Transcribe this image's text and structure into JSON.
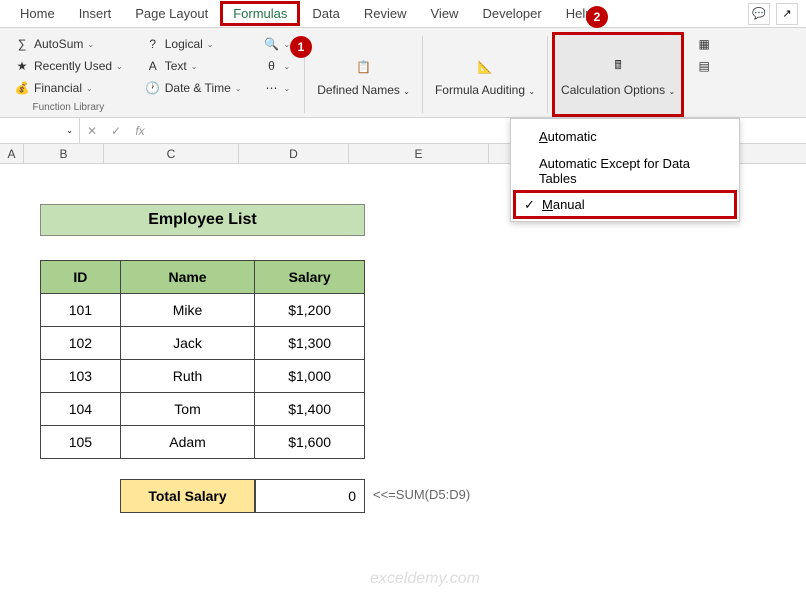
{
  "tabs": [
    "Home",
    "Insert",
    "Page Layout",
    "Formulas",
    "Data",
    "Review",
    "View",
    "Developer",
    "Help"
  ],
  "ribbon": {
    "autosum": "AutoSum",
    "recently": "Recently Used",
    "financial": "Financial",
    "logical": "Logical",
    "text": "Text",
    "datetime": "Date & Time",
    "defined": "Defined Names",
    "auditing": "Formula Auditing",
    "calcopt": "Calculation Options",
    "group_label": "Function Library"
  },
  "menu": {
    "auto": "Automatic",
    "auto_except": "Automatic Except for Data Tables",
    "manual": "Manual"
  },
  "callouts": {
    "one": "1",
    "two": "2"
  },
  "formula_bar": {
    "fx": "fx"
  },
  "cols": {
    "A": "A",
    "B": "B",
    "C": "C",
    "D": "D",
    "E": "E"
  },
  "sheet": {
    "title": "Employee List",
    "headers": {
      "id": "ID",
      "name": "Name",
      "salary": "Salary"
    },
    "rows": [
      {
        "id": "101",
        "name": "Mike",
        "salary": "$1,200"
      },
      {
        "id": "102",
        "name": "Jack",
        "salary": "$1,300"
      },
      {
        "id": "103",
        "name": "Ruth",
        "salary": "$1,000"
      },
      {
        "id": "104",
        "name": "Tom",
        "salary": "$1,400"
      },
      {
        "id": "105",
        "name": "Adam",
        "salary": "$1,600"
      }
    ],
    "total_label": "Total Salary",
    "total_value": "0",
    "total_note": "<<=SUM(D5:D9)"
  },
  "watermark": "exceldemy.com"
}
